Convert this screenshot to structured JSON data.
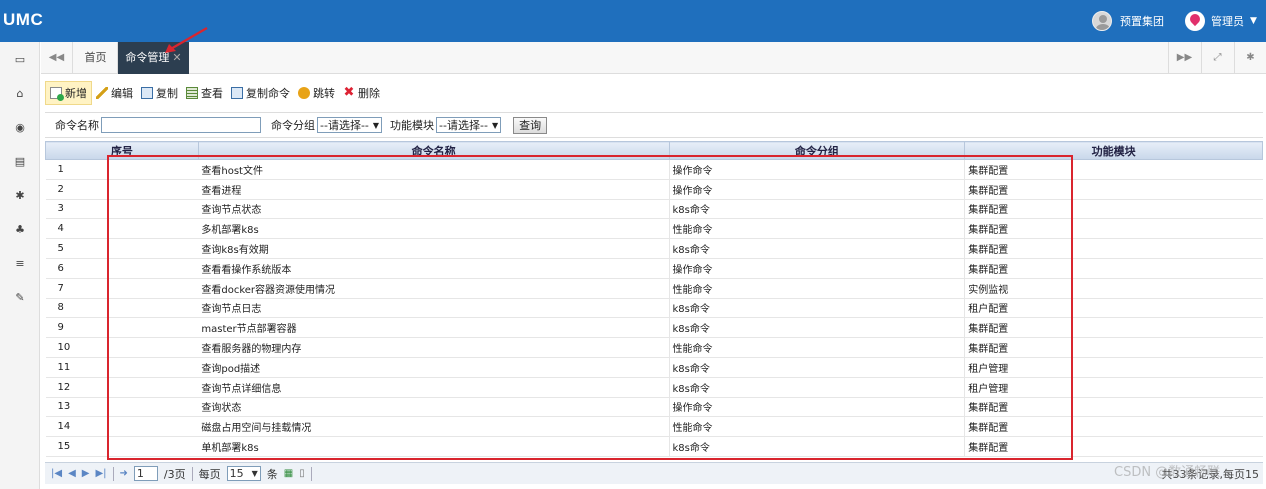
{
  "header": {
    "logo": "UMC",
    "group": "预置集团",
    "user": "管理员"
  },
  "tabs": {
    "home": "首页",
    "active": "命令管理"
  },
  "toolbar": {
    "new": "新增",
    "edit": "编辑",
    "copy": "复制",
    "view": "查看",
    "copy_cmd": "复制命令",
    "jump": "跳转",
    "delete": "删除"
  },
  "filter": {
    "name_label": "命令名称",
    "group_label": "命令分组",
    "group_value": "--请选择--",
    "module_label": "功能模块",
    "module_value": "--请选择--",
    "query": "查询"
  },
  "columns": [
    "序号",
    "命令名称",
    "命令分组",
    "功能模块"
  ],
  "rows": [
    [
      "1",
      "查看host文件",
      "操作命令",
      "集群配置"
    ],
    [
      "2",
      "查看进程",
      "操作命令",
      "集群配置"
    ],
    [
      "3",
      "查询节点状态",
      "k8s命令",
      "集群配置"
    ],
    [
      "4",
      "多机部署k8s",
      "性能命令",
      "集群配置"
    ],
    [
      "5",
      "查询k8s有效期",
      "k8s命令",
      "集群配置"
    ],
    [
      "6",
      "查看看操作系统版本",
      "操作命令",
      "集群配置"
    ],
    [
      "7",
      "查看docker容器资源使用情况",
      "性能命令",
      "实例监视"
    ],
    [
      "8",
      "查询节点日志",
      "k8s命令",
      "租户配置"
    ],
    [
      "9",
      "master节点部署容器",
      "k8s命令",
      "集群配置"
    ],
    [
      "10",
      "查看服务器的物理内存",
      "性能命令",
      "集群配置"
    ],
    [
      "11",
      "查询pod描述",
      "k8s命令",
      "租户管理"
    ],
    [
      "12",
      "查询节点详细信息",
      "k8s命令",
      "租户管理"
    ],
    [
      "13",
      "查询状态",
      "操作命令",
      "集群配置"
    ],
    [
      "14",
      "磁盘占用空间与挂载情况",
      "性能命令",
      "集群配置"
    ],
    [
      "15",
      "单机部署k8s",
      "k8s命令",
      "集群配置"
    ]
  ],
  "pager": {
    "page": "1",
    "total_pages": "/3页",
    "per_page_label": "每页",
    "per_page": "15",
    "unit": "条",
    "info": "共33条记录,每页15"
  },
  "watermark": "CSDN @数通畅联"
}
